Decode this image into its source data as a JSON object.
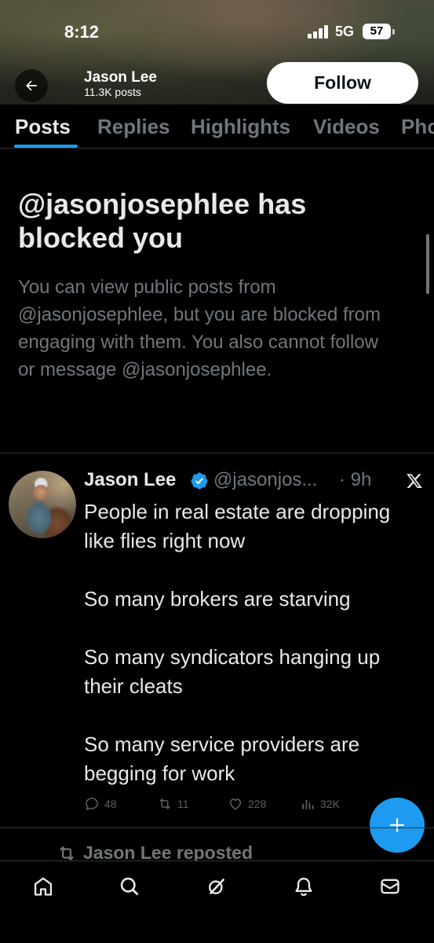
{
  "status_bar": {
    "time": "8:12",
    "network": "5G",
    "battery": "57"
  },
  "header": {
    "profile_name": "Jason Lee",
    "post_count": "11.3K posts",
    "follow_label": "Follow"
  },
  "tabs": [
    {
      "label": "Posts",
      "active": true
    },
    {
      "label": "Replies",
      "active": false
    },
    {
      "label": "Highlights",
      "active": false
    },
    {
      "label": "Videos",
      "active": false
    },
    {
      "label": "Pho",
      "active": false
    }
  ],
  "blocked": {
    "title": "@jasonjosephlee has blocked you",
    "description": "You can view public posts from @jasonjosephlee, but you are blocked from engaging with them. You also cannot follow or message @jasonjosephlee."
  },
  "tweet": {
    "author_name": "Jason Lee",
    "handle": "@jasonjos...",
    "time": "· 9h",
    "paragraphs": [
      "People in real estate are dropping like flies right now",
      "So many brokers are starving",
      "So many syndicators hanging up their cleats",
      "So many service providers are begging for work"
    ],
    "replies": "48",
    "reposts": "11",
    "likes": "228",
    "views": "32K"
  },
  "repost_label": "Jason Lee reposted",
  "icons": {
    "back": "arrow-left-icon",
    "verified": "verified-badge-icon",
    "x_logo": "x-logo-icon",
    "fab": "plus-icon",
    "nav": [
      "home-icon",
      "search-icon",
      "grok-icon",
      "bell-icon",
      "mail-icon"
    ]
  },
  "colors": {
    "accent": "#1d9bf0",
    "muted": "#71767b",
    "text": "#e7e9ea",
    "background": "#000000"
  }
}
